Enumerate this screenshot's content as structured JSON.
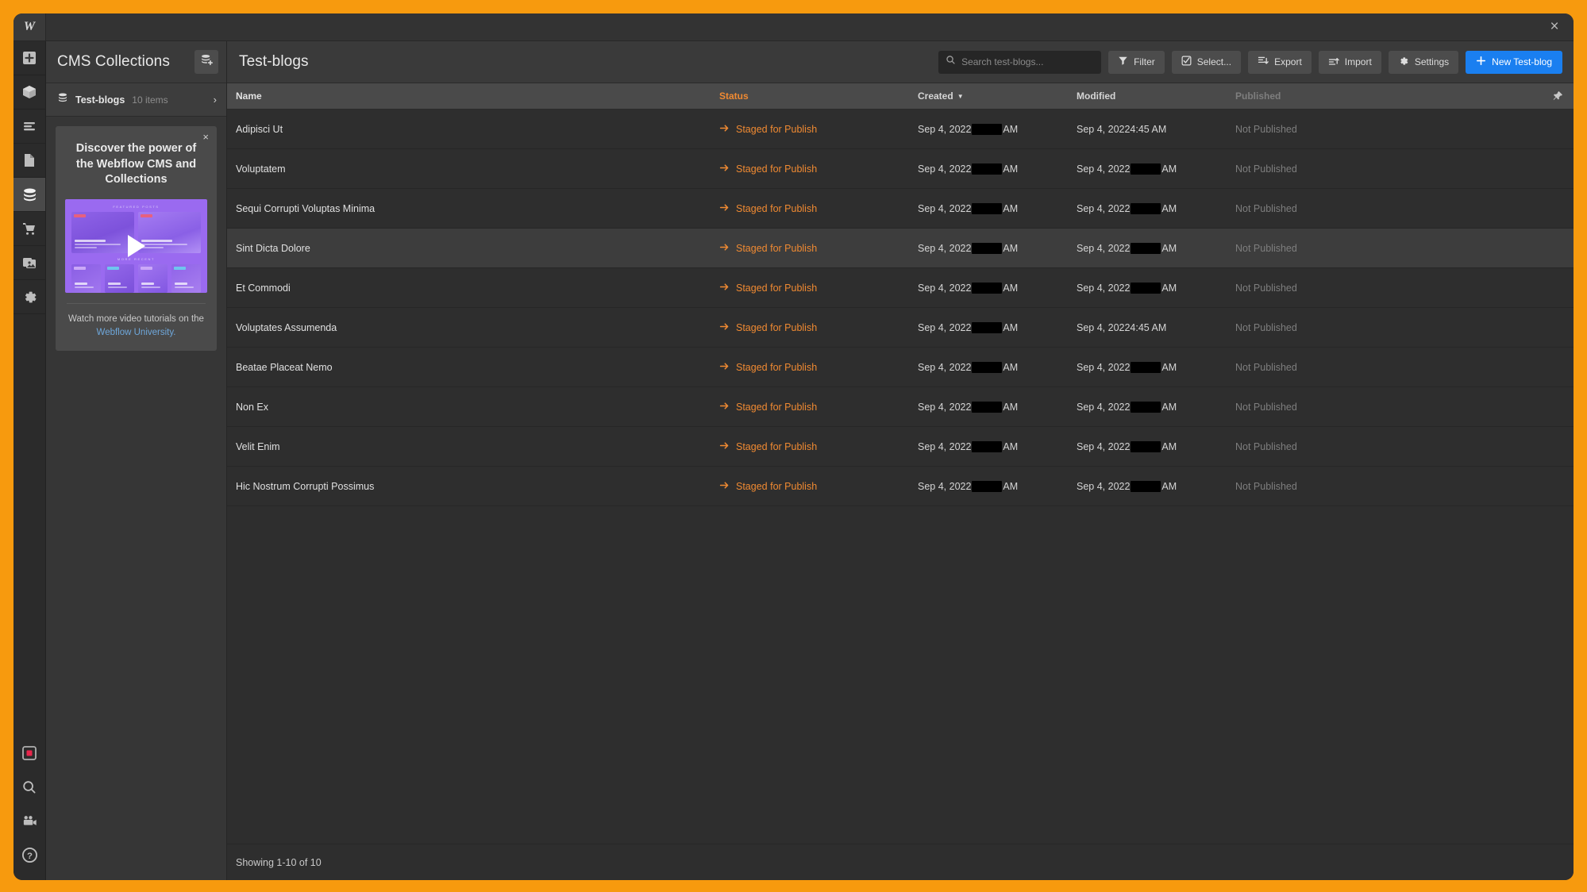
{
  "titlebar": {
    "logo": "W",
    "close_label": "×"
  },
  "rail": {
    "top_items": [
      {
        "name": "add-panel",
        "icon": "plus-square-icon",
        "active": false
      },
      {
        "name": "components-panel",
        "icon": "cube-icon",
        "active": false
      },
      {
        "name": "navigator-panel",
        "icon": "list-lines-icon",
        "active": false
      },
      {
        "name": "pages-panel",
        "icon": "page-icon",
        "active": false
      },
      {
        "name": "cms-panel",
        "icon": "database-icon",
        "active": true
      },
      {
        "name": "ecommerce-panel",
        "icon": "cart-icon",
        "active": false
      },
      {
        "name": "assets-panel",
        "icon": "images-icon",
        "active": false
      },
      {
        "name": "settings-panel",
        "icon": "gear-icon",
        "active": false
      }
    ],
    "bottom_items": [
      {
        "name": "recording-indicator",
        "icon": "record-square-icon"
      },
      {
        "name": "search-button",
        "icon": "search-icon"
      },
      {
        "name": "video-button",
        "icon": "video-camera-icon"
      },
      {
        "name": "help-button",
        "icon": "question-mark-icon"
      }
    ]
  },
  "collections": {
    "title": "CMS Collections",
    "new_collection_icon": "database-plus-icon",
    "items": [
      {
        "name": "Test-blogs",
        "count": "10 items",
        "icon": "database-icon",
        "chevron": "›"
      }
    ]
  },
  "promo": {
    "close_label": "×",
    "title": "Discover the power of the Webflow CMS and Collections",
    "thumb_label_top": "FEATURED POSTS",
    "thumb_label_mid": "MORE RECENT",
    "foot_text": "Watch more video tutorials on the",
    "link_text": "Webflow University.",
    "play_icon": "play-icon"
  },
  "main": {
    "title": "Test-blogs",
    "search": {
      "placeholder": "Search test-blogs...",
      "value": "",
      "icon": "search-icon"
    },
    "buttons": [
      {
        "label": "Filter",
        "icon": "funnel-icon",
        "name": "filter-button"
      },
      {
        "label": "Select...",
        "icon": "checkbox-icon",
        "name": "select-button"
      },
      {
        "label": "Export",
        "icon": "export-icon",
        "name": "export-button"
      },
      {
        "label": "Import",
        "icon": "import-icon",
        "name": "import-button"
      },
      {
        "label": "Settings",
        "icon": "gear-icon",
        "name": "settings-button"
      }
    ],
    "primary_button": {
      "label": "New Test-blog",
      "icon": "plus-icon",
      "name": "new-item-button"
    }
  },
  "table": {
    "columns": {
      "name": "Name",
      "status": "Status",
      "created": "Created",
      "created_sort": "▼",
      "modified": "Modified",
      "published": "Published",
      "pin_icon": "pin-icon"
    },
    "rows": [
      {
        "name": "Adipisci Ut",
        "status": "Staged for Publish",
        "created_prefix": "Sep 4, 2022",
        "created_redacted": true,
        "created_suffix": "AM",
        "modified_prefix": "Sep 4, 2022",
        "modified_redacted": false,
        "modified_time": "4:45 AM",
        "published": "Not Published",
        "hovered": false
      },
      {
        "name": "Voluptatem",
        "status": "Staged for Publish",
        "created_prefix": "Sep 4, 2022",
        "created_redacted": true,
        "created_suffix": "AM",
        "modified_prefix": "Sep 4, 2022",
        "modified_redacted": true,
        "modified_time": "AM",
        "published": "Not Published",
        "hovered": false
      },
      {
        "name": "Sequi Corrupti Voluptas Minima",
        "status": "Staged for Publish",
        "created_prefix": "Sep 4, 2022",
        "created_redacted": true,
        "created_suffix": "AM",
        "modified_prefix": "Sep 4, 2022",
        "modified_redacted": true,
        "modified_time": "AM",
        "published": "Not Published",
        "hovered": false
      },
      {
        "name": "Sint Dicta Dolore",
        "status": "Staged for Publish",
        "created_prefix": "Sep 4, 2022",
        "created_redacted": true,
        "created_suffix": "AM",
        "modified_prefix": "Sep 4, 2022",
        "modified_redacted": true,
        "modified_time": "AM",
        "published": "Not Published",
        "hovered": true
      },
      {
        "name": "Et Commodi",
        "status": "Staged for Publish",
        "created_prefix": "Sep 4, 2022",
        "created_redacted": true,
        "created_suffix": "AM",
        "modified_prefix": "Sep 4, 2022",
        "modified_redacted": true,
        "modified_time": "AM",
        "published": "Not Published",
        "hovered": false
      },
      {
        "name": "Voluptates Assumenda",
        "status": "Staged for Publish",
        "created_prefix": "Sep 4, 2022",
        "created_redacted": true,
        "created_suffix": "AM",
        "modified_prefix": "Sep 4, 2022",
        "modified_redacted": false,
        "modified_time": "4:45 AM",
        "published": "Not Published",
        "hovered": false
      },
      {
        "name": "Beatae Placeat Nemo",
        "status": "Staged for Publish",
        "created_prefix": "Sep 4, 2022",
        "created_redacted": true,
        "created_suffix": "AM",
        "modified_prefix": "Sep 4, 2022",
        "modified_redacted": true,
        "modified_time": "AM",
        "published": "Not Published",
        "hovered": false
      },
      {
        "name": "Non Ex",
        "status": "Staged for Publish",
        "created_prefix": "Sep 4, 2022",
        "created_redacted": true,
        "created_suffix": "AM",
        "modified_prefix": "Sep 4, 2022",
        "modified_redacted": true,
        "modified_time": "AM",
        "published": "Not Published",
        "hovered": false
      },
      {
        "name": "Velit Enim",
        "status": "Staged for Publish",
        "created_prefix": "Sep 4, 2022",
        "created_redacted": true,
        "created_suffix": "AM",
        "modified_prefix": "Sep 4, 2022",
        "modified_redacted": true,
        "modified_time": "AM",
        "published": "Not Published",
        "hovered": false
      },
      {
        "name": "Hic Nostrum Corrupti Possimus",
        "status": "Staged for Publish",
        "created_prefix": "Sep 4, 2022",
        "created_redacted": true,
        "created_suffix": "AM",
        "modified_prefix": "Sep 4, 2022",
        "modified_redacted": true,
        "modified_time": "AM",
        "published": "Not Published",
        "hovered": false
      }
    ],
    "footer": "Showing 1-10 of 10",
    "status_icon": "arrow-right-icon"
  },
  "colors": {
    "desktop_bg": "#f79a0e",
    "window_bg": "#2e2e2e",
    "panel_bg": "#363636",
    "header_bg": "#3a3a3a",
    "table_header_bg": "#4a4a4a",
    "accent_blue": "#1a7ff0",
    "status_orange": "#f08a32",
    "link_blue": "#6fa8dc",
    "promo_purple": "#9a6af0"
  }
}
